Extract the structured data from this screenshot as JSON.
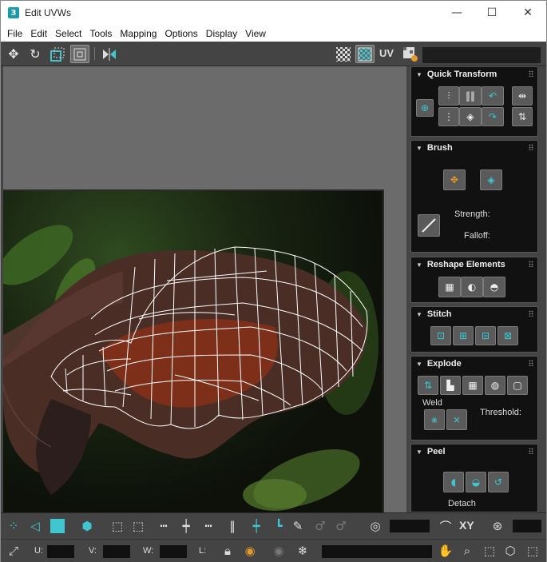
{
  "window": {
    "title": "Edit UVWs",
    "app_icon_glyph": "3"
  },
  "window_controls": {
    "minimize": "—",
    "maximize": "☐",
    "close": "✕"
  },
  "menu": [
    "File",
    "Edit",
    "Select",
    "Tools",
    "Mapping",
    "Options",
    "Display",
    "View"
  ],
  "toolbar_top": {
    "uv_label": "UV",
    "icons": [
      "move-icon",
      "rotate-icon",
      "scale-icon",
      "freeform-icon",
      "mirror-icon",
      "checker-pattern-icon",
      "checker-active-icon",
      "texture-settings-icon"
    ]
  },
  "panel": {
    "quick_transform": {
      "title": "Quick Transform"
    },
    "brush": {
      "title": "Brush",
      "strength_label": "Strength:",
      "falloff_label": "Falloff:"
    },
    "reshape": {
      "title": "Reshape Elements"
    },
    "stitch": {
      "title": "Stitch"
    },
    "explode": {
      "title": "Explode",
      "weld_label": "Weld",
      "threshold_label": "Threshold:"
    },
    "peel": {
      "title": "Peel",
      "detach_label": "Detach"
    }
  },
  "bottom": {
    "xy_label": "XY",
    "u_label": "U:",
    "v_label": "V:",
    "w_label": "W:",
    "l_label": "L:"
  },
  "colors": {
    "accent": "#3fc6d1",
    "panel_bg": "#111111",
    "ui_bg": "#444444",
    "viewport_bg": "#6b6b6b"
  }
}
